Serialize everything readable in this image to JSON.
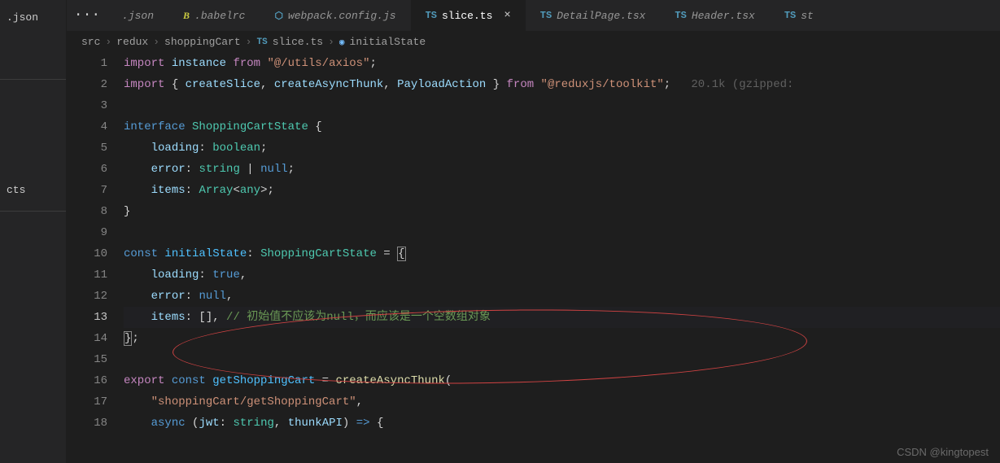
{
  "sidebar": {
    "item1": ".json",
    "item2": "cts"
  },
  "tabs": {
    "more": "···",
    "items": [
      {
        "icon": "",
        "label": ".json"
      },
      {
        "icon": "B",
        "label": ".babelrc"
      },
      {
        "icon": "⬡",
        "label": "webpack.config.js"
      },
      {
        "icon": "TS",
        "label": "slice.ts",
        "active": true,
        "close": "×"
      },
      {
        "icon": "TS",
        "label": "DetailPage.tsx"
      },
      {
        "icon": "TS",
        "label": "Header.tsx"
      },
      {
        "icon": "TS",
        "label": "st"
      }
    ]
  },
  "breadcrumbs": {
    "items": [
      "src",
      "redux",
      "shoppingCart"
    ],
    "fileIcon": "TS",
    "fileName": "slice.ts",
    "varIcon": "◉",
    "varName": "initialState",
    "sep": "›"
  },
  "gutter": {
    "lines": [
      "1",
      "2",
      "3",
      "4",
      "5",
      "6",
      "7",
      "8",
      "9",
      "10",
      "11",
      "12",
      "13",
      "14",
      "15",
      "16",
      "17",
      "18"
    ],
    "current": "13"
  },
  "code": {
    "line1": {
      "t1": "import ",
      "t2": "instance ",
      "t3": "from ",
      "t4": "\"@/utils/axios\"",
      "t5": ";"
    },
    "line2": {
      "t1": "import ",
      "t2": "{ ",
      "t3": "createSlice",
      "t4": ", ",
      "t5": "createAsyncThunk",
      "t6": ", ",
      "t7": "PayloadAction",
      "t8": " } ",
      "t9": "from ",
      "t10": "\"@reduxjs/toolkit\"",
      "t11": ";",
      "hint": "   20.1k (gzipped:"
    },
    "line4": {
      "t1": "interface ",
      "t2": "ShoppingCartState ",
      "t3": "{"
    },
    "line5": {
      "t1": "    ",
      "t2": "loading",
      "t3": ": ",
      "t4": "boolean",
      "t5": ";"
    },
    "line6": {
      "t1": "    ",
      "t2": "error",
      "t3": ": ",
      "t4": "string ",
      "t5": "| ",
      "t6": "null",
      "t7": ";"
    },
    "line7": {
      "t1": "    ",
      "t2": "items",
      "t3": ": ",
      "t4": "Array",
      "t5": "<",
      "t6": "any",
      "t7": ">;"
    },
    "line8": {
      "t1": "}"
    },
    "line10": {
      "t1": "const ",
      "t2": "initialState",
      "t3": ": ",
      "t4": "ShoppingCartState ",
      "t5": "= ",
      "t6": "{"
    },
    "line11": {
      "t1": "    ",
      "t2": "loading",
      "t3": ": ",
      "t4": "true",
      "t5": ","
    },
    "line12": {
      "t1": "    ",
      "t2": "error",
      "t3": ": ",
      "t4": "null",
      "t5": ","
    },
    "line13": {
      "t1": "    ",
      "t2": "items",
      "t3": ": [], ",
      "t4": "// 初始值不应该为null，而应该是一个空数组对象"
    },
    "line14": {
      "t1": "}",
      "t2": ";"
    },
    "line16": {
      "t1": "export ",
      "t2": "const ",
      "t3": "getShoppingCart ",
      "t4": "= ",
      "t5": "createAsyncThunk",
      "t6": "("
    },
    "line17": {
      "t1": "    ",
      "t2": "\"shoppingCart/getShoppingCart\"",
      "t3": ","
    },
    "line18": {
      "t1": "    ",
      "t2": "async ",
      "t3": "(",
      "t4": "jwt",
      "t5": ": ",
      "t6": "string",
      "t7": ", ",
      "t8": "thunkAPI",
      "t9": ") ",
      "t10": "=> ",
      "t11": "{"
    }
  },
  "watermark": "CSDN @kingtopest"
}
